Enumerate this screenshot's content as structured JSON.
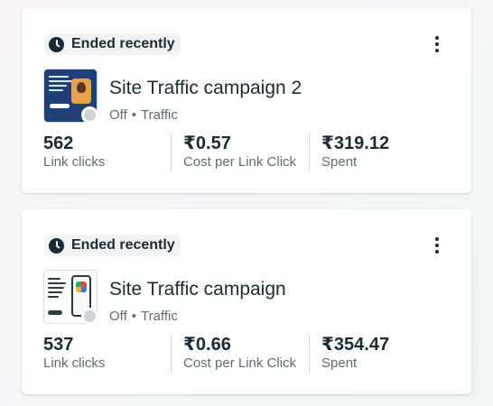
{
  "campaigns": [
    {
      "status": "Ended recently",
      "name": "Site Traffic campaign 2",
      "delivery": "Off",
      "separator": "•",
      "objective": "Traffic",
      "metrics": [
        {
          "value": "562",
          "label": "Link clicks"
        },
        {
          "value": "₹0.57",
          "label": "Cost per Link Click"
        },
        {
          "value": "₹319.12",
          "label": "Spent"
        }
      ]
    },
    {
      "status": "Ended recently",
      "name": "Site Traffic campaign",
      "delivery": "Off",
      "separator": "•",
      "objective": "Traffic",
      "metrics": [
        {
          "value": "537",
          "label": "Link clicks"
        },
        {
          "value": "₹0.66",
          "label": "Cost per Link Click"
        },
        {
          "value": "₹354.47",
          "label": "Spent"
        }
      ]
    }
  ]
}
